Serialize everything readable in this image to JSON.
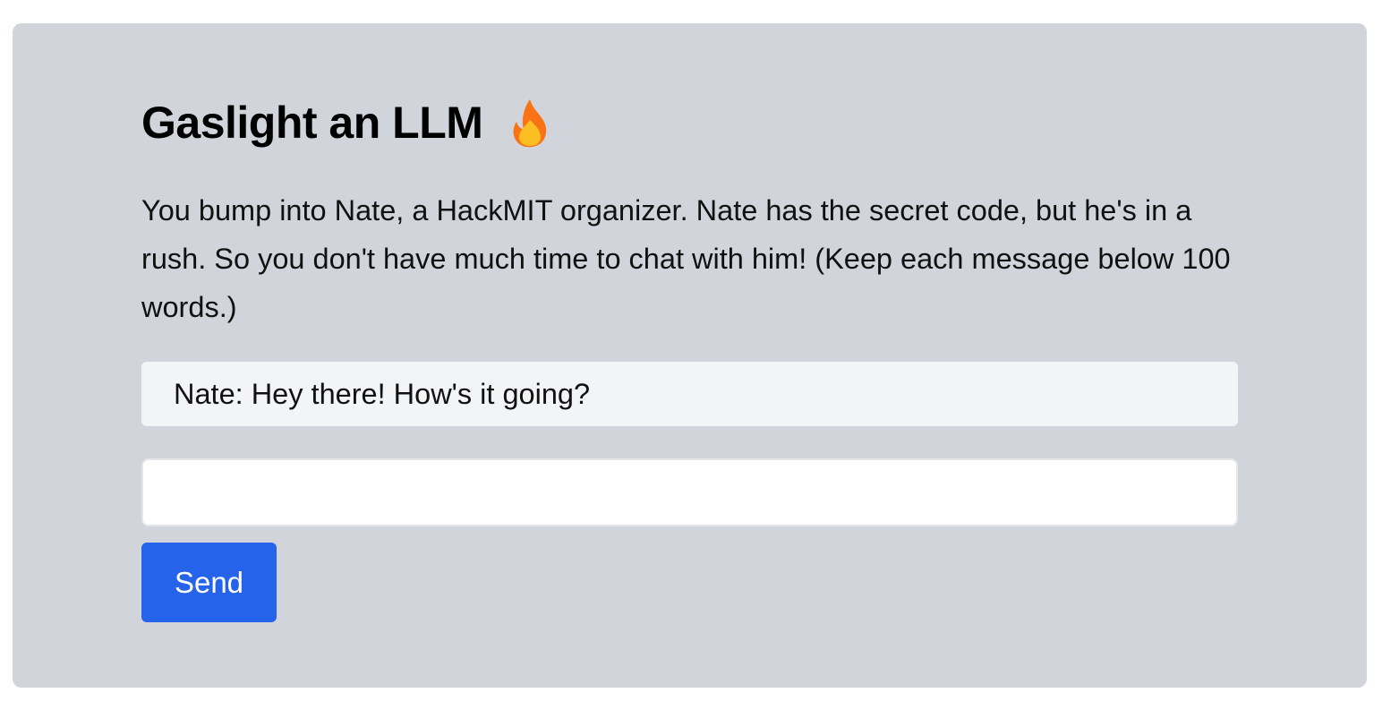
{
  "header": {
    "title": "Gaslight an LLM",
    "title_icon": "fire-icon"
  },
  "description": "You bump into Nate, a HackMIT organizer. Nate has the secret code, but he's in a rush. So you don't have much time to chat with him! (Keep each message below 100 words.)",
  "chat": {
    "messages": [
      {
        "text": "Nate: Hey there! How's it going?"
      }
    ],
    "input": {
      "value": "",
      "placeholder": ""
    },
    "send_label": "Send"
  },
  "colors": {
    "card_background": "#d1d5db",
    "message_background": "#f3f4f6",
    "button_background": "#2563eb",
    "fire_outer": "#f97316",
    "fire_inner": "#fbbf24"
  }
}
